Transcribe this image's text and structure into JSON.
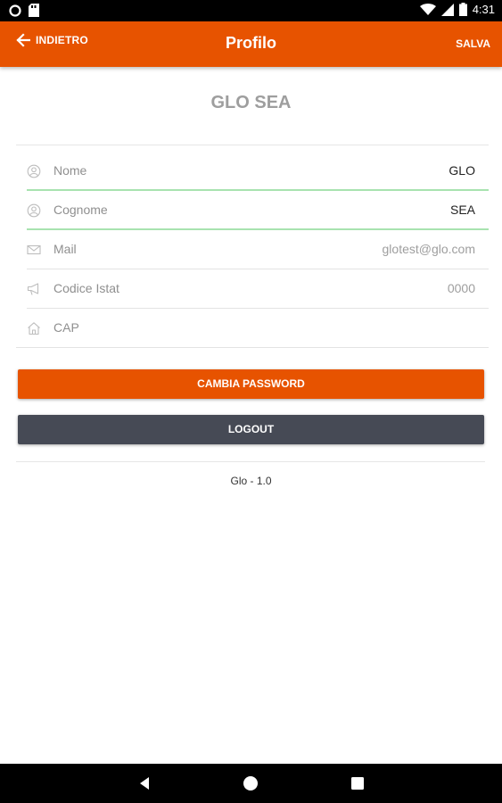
{
  "status_bar": {
    "time": "4:31",
    "icons": [
      "notification-dot-icon",
      "sd-card-icon",
      "wifi-icon",
      "signal-icon",
      "battery-icon"
    ]
  },
  "toolbar": {
    "back_label": "INDIETRO",
    "title": "Profilo",
    "save_label": "SALVA"
  },
  "profile": {
    "display_name": "GLO SEA"
  },
  "fields": [
    {
      "label": "Nome",
      "value": "GLO",
      "icon": "user-icon",
      "focused": true
    },
    {
      "label": "Cognome",
      "value": "SEA",
      "icon": "user-icon",
      "focused": true
    },
    {
      "label": "Mail",
      "value": "glotest@glo.com",
      "icon": "mail-icon",
      "focused": false
    },
    {
      "label": "Codice Istat",
      "value": "0000",
      "icon": "megaphone-icon",
      "focused": false
    },
    {
      "label": "CAP",
      "value": "",
      "icon": "home-icon",
      "focused": false
    }
  ],
  "buttons": {
    "change_password": "CAMBIA PASSWORD",
    "logout": "LOGOUT"
  },
  "version": "Glo - 1.0",
  "colors": {
    "accent": "#e75300",
    "logout_bg": "#464a55",
    "focus_underline": "#a8e3b0"
  }
}
